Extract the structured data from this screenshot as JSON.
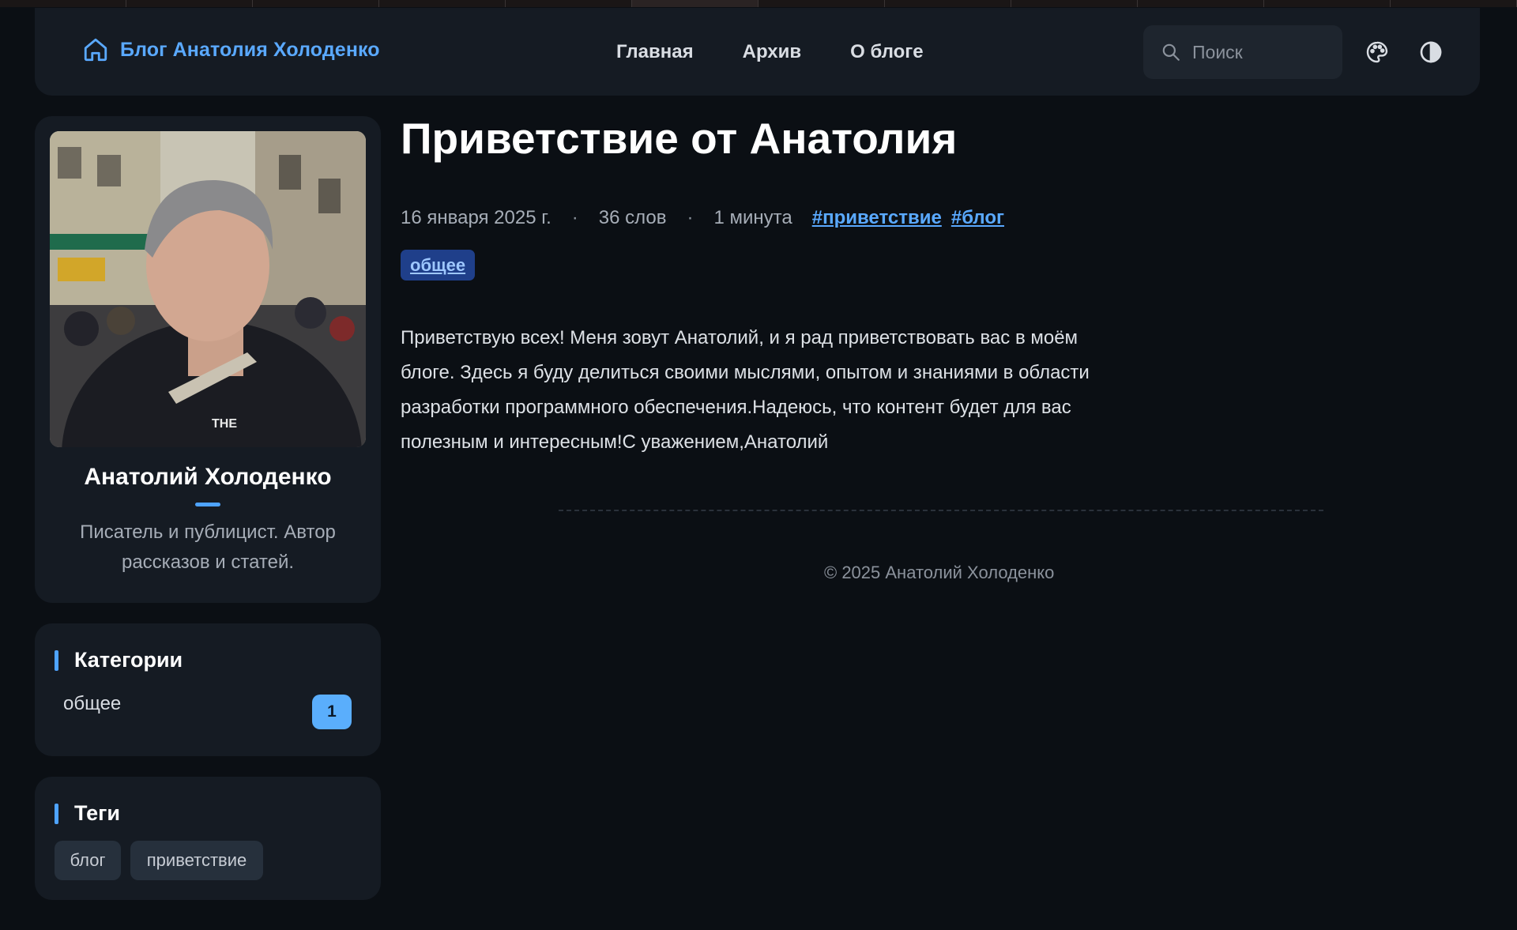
{
  "header": {
    "brand_title": "Блог Анатолия Холоденко",
    "nav": [
      "Главная",
      "Архив",
      "О блоге"
    ],
    "search_placeholder": "Поиск",
    "accent_color": "#5aa9ff",
    "icons": [
      "home-icon",
      "search-icon",
      "palette-icon",
      "contrast-icon"
    ]
  },
  "profile": {
    "name": "Анатолий Холоденко",
    "bio": "Писатель и публицист. Автор рассказов и статей."
  },
  "categories": {
    "title": "Категории",
    "items": [
      {
        "label": "общее",
        "count": "1"
      }
    ]
  },
  "tags": {
    "title": "Теги",
    "items": [
      "блог",
      "приветствие"
    ]
  },
  "post": {
    "title": "Приветствие от Анатолия",
    "date": "16 января 2025 г.",
    "words": "36 слов",
    "read_time": "1 минута",
    "tags": [
      "#приветствие",
      "#блог"
    ],
    "category": "общее",
    "body": "Приветствую всех! Меня зовут Анатолий, и я рад приветствовать вас в моём блоге. Здесь я буду делиться своими мыслями, опытом и знаниями в области разработки программного обеспечения.Надеюсь, что контент будет для вас полезным и интересным!С уважением,Анатолий"
  },
  "footer": {
    "copyright": "© 2025 Анатолий Холоденко"
  }
}
